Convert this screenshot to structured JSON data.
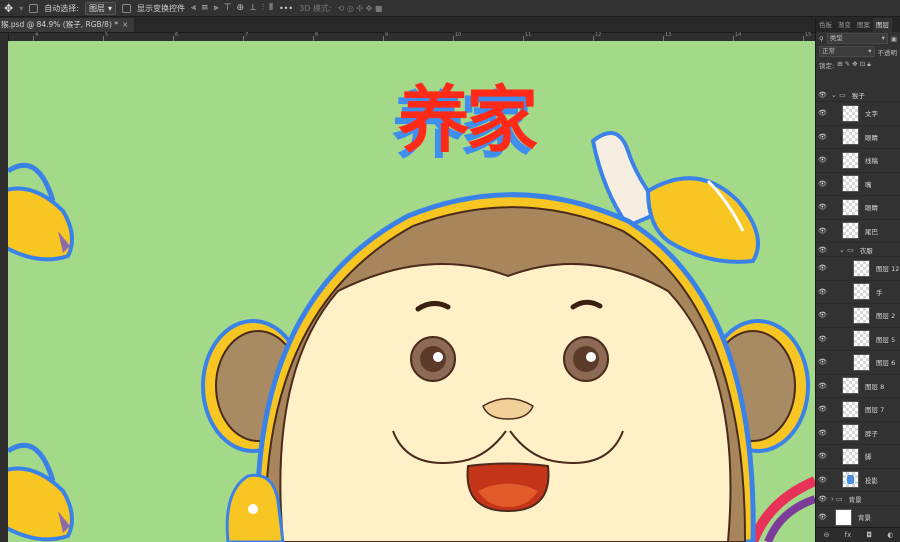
{
  "options_bar": {
    "move_tool": "✥",
    "auto_select_label": "自动选择:",
    "auto_select_value": "图层",
    "show_transform_label": "显示变换控件",
    "more": "•••",
    "mode_3d_label": "3D 模式:"
  },
  "document": {
    "tab_title": "猴.psd @ 84.9% (猴子, RGB/8) *",
    "close": "×"
  },
  "ruler": {
    "numbers": [
      "4",
      "5",
      "6",
      "7",
      "8",
      "9",
      "10",
      "11",
      "12",
      "13",
      "14",
      "15",
      "16"
    ]
  },
  "canvas": {
    "title_text": "养家",
    "colors": {
      "background": "#a4d98a",
      "title_red": "#ff2a18",
      "title_blue": "#3f8ff0"
    }
  },
  "panel": {
    "tabs": [
      "色板",
      "渐变",
      "图案",
      "图层"
    ],
    "active_tab": "图层",
    "filter_label": "类型",
    "blend_mode": "正常",
    "opacity_label": "不透明",
    "lock_label": "锁定:",
    "layers": [
      {
        "name": "猴子",
        "type": "group",
        "level": 0
      },
      {
        "name": "文字",
        "type": "layer",
        "level": 1
      },
      {
        "name": "眼睛",
        "type": "layer",
        "level": 1
      },
      {
        "name": "线稿",
        "type": "layer",
        "level": 1
      },
      {
        "name": "嘴",
        "type": "layer",
        "level": 1
      },
      {
        "name": "眼睛",
        "type": "layer",
        "level": 1
      },
      {
        "name": "尾巴",
        "type": "layer",
        "level": 1
      },
      {
        "name": "衣服",
        "type": "group",
        "level": 1
      },
      {
        "name": "图层 12",
        "type": "layer",
        "level": 2
      },
      {
        "name": "手",
        "type": "layer",
        "level": 2
      },
      {
        "name": "图层 2",
        "type": "layer",
        "level": 2
      },
      {
        "name": "图层 5",
        "type": "layer",
        "level": 2
      },
      {
        "name": "图层 6",
        "type": "layer",
        "level": 2
      },
      {
        "name": "图层 8",
        "type": "layer",
        "level": 1
      },
      {
        "name": "图层 7",
        "type": "layer",
        "level": 1
      },
      {
        "name": "脖子",
        "type": "layer",
        "level": 1
      },
      {
        "name": "脚",
        "type": "layer",
        "level": 1
      },
      {
        "name": "投影",
        "type": "layer",
        "level": 1
      },
      {
        "name": "背景",
        "type": "group",
        "level": 0
      },
      {
        "name": "背景",
        "type": "layer",
        "level": 0
      }
    ],
    "footer_icons": [
      "link-icon",
      "fx-icon",
      "mask-icon",
      "adjustment-icon"
    ],
    "footer_labels": [
      "⊖",
      "fx",
      "◘",
      "◐"
    ]
  }
}
